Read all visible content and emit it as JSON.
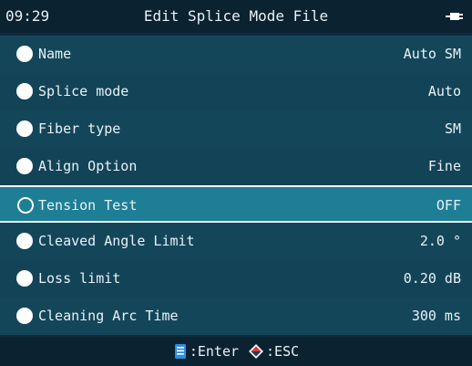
{
  "status": {
    "time": "09:29"
  },
  "header": {
    "title": "Edit Splice Mode File",
    "power_icon": "plug-icon"
  },
  "menu": {
    "items": [
      {
        "label": "Name",
        "value": "Auto SM"
      },
      {
        "label": "Splice mode",
        "value": "Auto"
      },
      {
        "label": "Fiber type",
        "value": "SM"
      },
      {
        "label": "Align Option",
        "value": "Fine"
      },
      {
        "label": "Tension Test",
        "value": "OFF",
        "selected": true
      },
      {
        "label": "Cleaved Angle Limit",
        "value": "2.0 °"
      },
      {
        "label": "Loss limit",
        "value": "0.20 dB"
      },
      {
        "label": "Cleaning Arc Time",
        "value": "300 ms"
      }
    ]
  },
  "footer": {
    "enter_label": ":Enter",
    "esc_label": ":ESC",
    "enter_icon": "file-enter-icon",
    "esc_icon": "diamond-esc-icon"
  },
  "colors": {
    "background": "#0f2a38",
    "titlebar": "#0b2230",
    "row": "#14465a",
    "selected_row": "#1e7e95",
    "text": "#e9f2f6",
    "enter_icon": "#2f8fe0",
    "esc_icon_top": "#d73b3b"
  }
}
